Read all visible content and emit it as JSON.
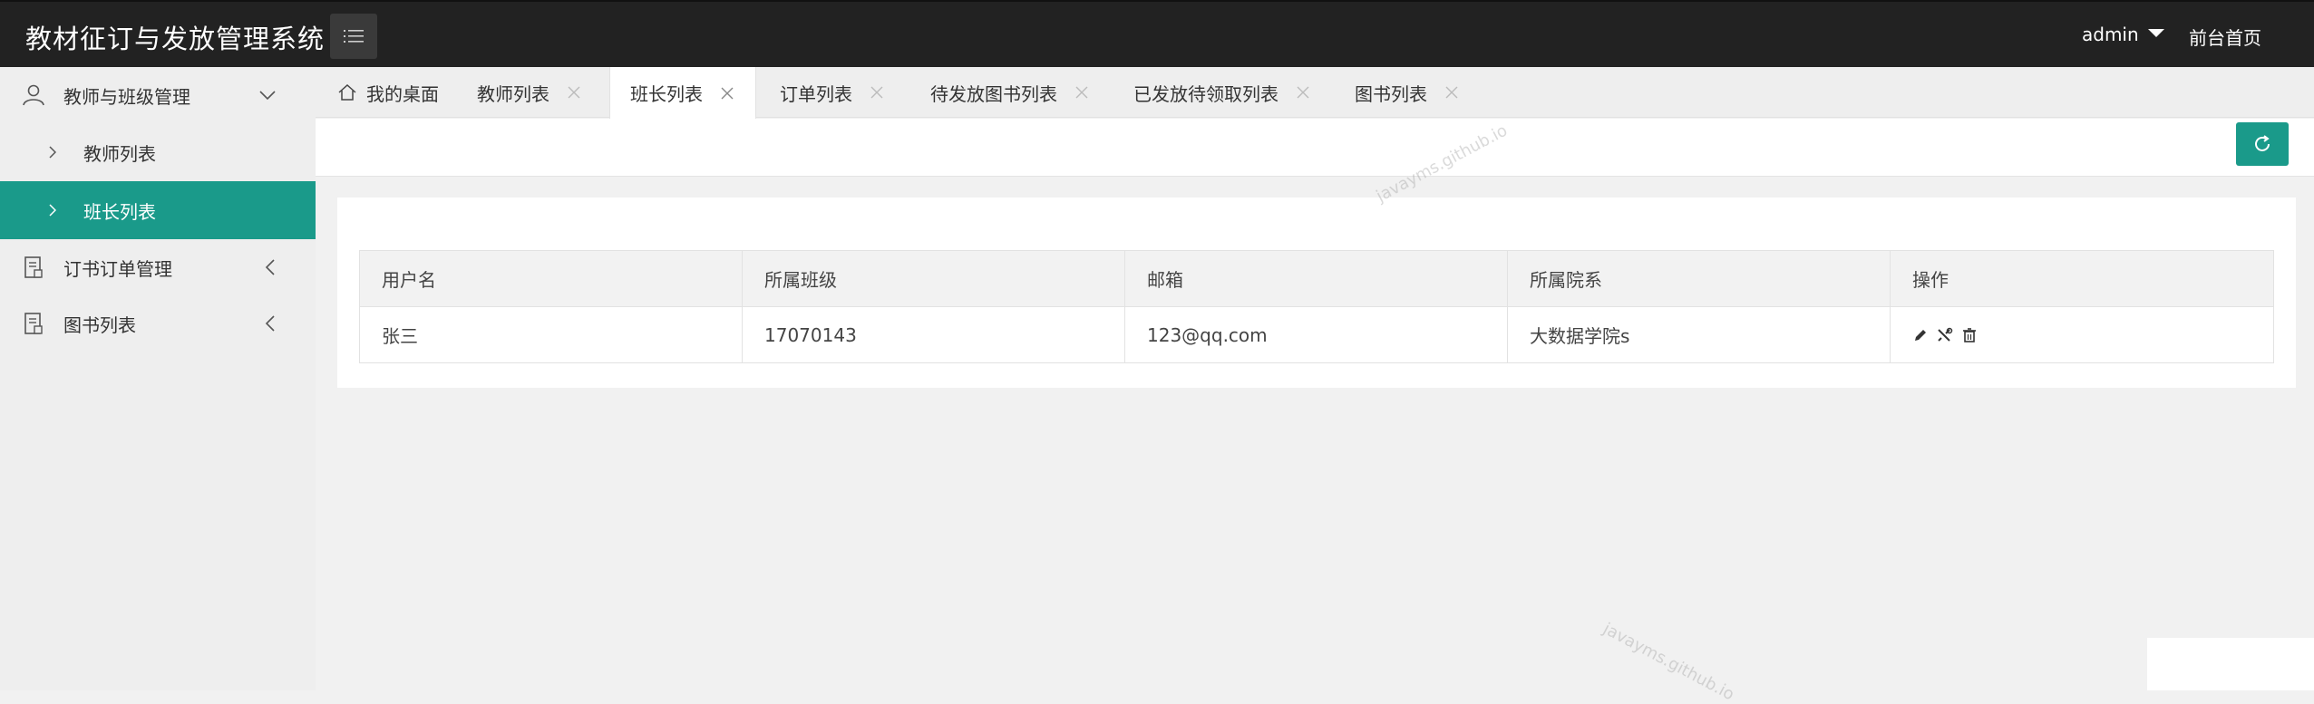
{
  "header": {
    "title": "教材征订与发放管理系统",
    "user": "admin",
    "front_link": "前台首页"
  },
  "sidebar": {
    "groups": [
      {
        "label": "教师与班级管理",
        "icon": "user-icon",
        "expanded": true,
        "items": [
          {
            "label": "教师列表",
            "active": false
          },
          {
            "label": "班长列表",
            "active": true
          }
        ]
      },
      {
        "label": "订书订单管理",
        "icon": "document-icon",
        "expanded": false
      },
      {
        "label": "图书列表",
        "icon": "document-icon",
        "expanded": false
      }
    ]
  },
  "tabs": [
    {
      "label": "我的桌面",
      "closable": false,
      "active": false
    },
    {
      "label": "教师列表",
      "closable": true,
      "active": false
    },
    {
      "label": "班长列表",
      "closable": true,
      "active": true
    },
    {
      "label": "订单列表",
      "closable": true,
      "active": false
    },
    {
      "label": "待发放图书列表",
      "closable": true,
      "active": false
    },
    {
      "label": "已发放待领取列表",
      "closable": true,
      "active": false
    },
    {
      "label": "图书列表",
      "closable": true,
      "active": false
    }
  ],
  "table": {
    "headers": [
      "用户名",
      "所属班级",
      "邮箱",
      "所属院系",
      "操作"
    ],
    "rows": [
      {
        "username": "张三",
        "class": "17070143",
        "email": "123@qq.com",
        "department": "大数据学院s"
      }
    ]
  },
  "watermark": "javayms.github.io",
  "colors": {
    "accent": "#1a9a8a",
    "header_bg": "#222222",
    "sidebar_bg": "#eeeeee"
  }
}
